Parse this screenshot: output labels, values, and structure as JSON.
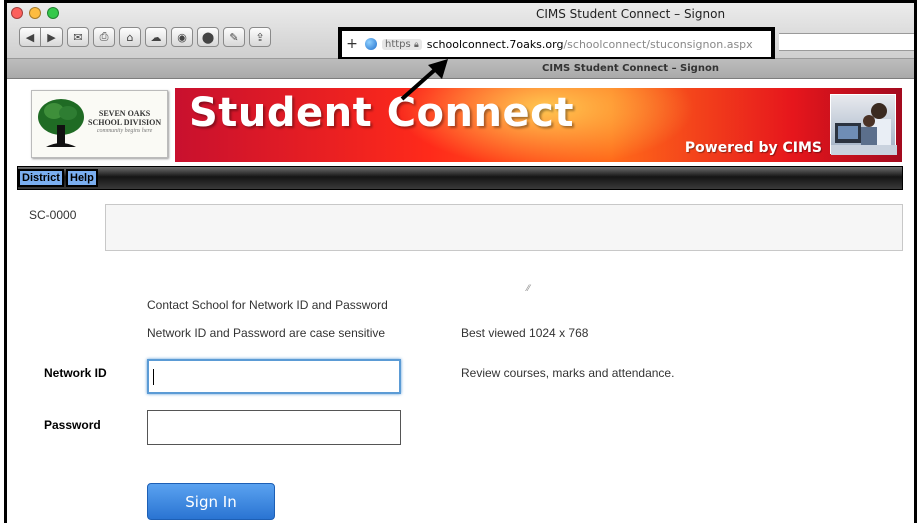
{
  "window": {
    "title": "CIMS Student Connect – Signon",
    "tab_label": "CIMS Student Connect – Signon"
  },
  "toolbar": {
    "back_icon": "back-icon",
    "forward_icon": "forward-icon",
    "plus": "+",
    "https_label": "https",
    "url_host": "schoolconnect.7oaks.org",
    "url_path": "/schoolconnect/stuconsignon.aspx"
  },
  "logo": {
    "line1": "SEVEN OAKS",
    "line2": "SCHOOL DIVISION",
    "tagline": "community begins here"
  },
  "banner": {
    "title": "Student Connect",
    "powered_by": "Powered by CIMS"
  },
  "nav": {
    "district": "District",
    "help": "Help"
  },
  "page": {
    "sc_code": "SC-0000",
    "contact_text": "Contact School for Network ID and Password",
    "case_text": "Network ID and Password are case sensitive",
    "best_viewed": "Best viewed 1024 x 768",
    "review_text": "Review courses, marks and attendance."
  },
  "form": {
    "network_id_label": "Network ID",
    "network_id_value": "",
    "password_label": "Password",
    "password_value": "",
    "signin_label": "Sign In"
  },
  "colors": {
    "banner_red": "#e6161c",
    "nav_button": "#7aaef0",
    "signin_button": "#2a74d2",
    "focus_ring": "#5b9bd5"
  }
}
